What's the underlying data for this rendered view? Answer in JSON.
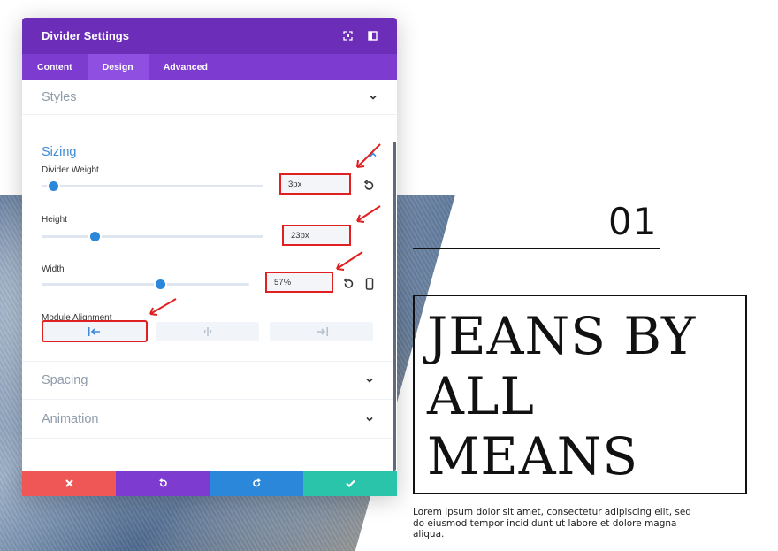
{
  "panel": {
    "title": "Divider Settings",
    "tabs": [
      {
        "label": "Content",
        "active": false
      },
      {
        "label": "Design",
        "active": true
      },
      {
        "label": "Advanced",
        "active": false
      }
    ],
    "sections": {
      "styles": "Styles",
      "sizing": "Sizing",
      "spacing": "Spacing",
      "animation": "Animation"
    },
    "fields": {
      "divider_weight": {
        "label": "Divider Weight",
        "value": "3px",
        "level": 0.05
      },
      "height": {
        "label": "Height",
        "value": "23px",
        "level": 0.24
      },
      "width": {
        "label": "Width",
        "value": "57%",
        "level": 0.57
      },
      "module_alignment": {
        "label": "Module Alignment",
        "selected": "left",
        "options": [
          "left",
          "center",
          "right"
        ]
      }
    },
    "colors": {
      "header": "#6c2eb9",
      "tabs": "#7d3bd0",
      "accent": "#2b87da",
      "cancel": "#ef5656",
      "undo": "#7d3bd0",
      "redo": "#2b87da",
      "save": "#29c4a9",
      "highlight": "#e02020"
    }
  },
  "content": {
    "number": "01",
    "headline_lines": [
      "JEANS BY",
      "ALL",
      "MEANS"
    ],
    "lorem": "Lorem ipsum dolor sit amet, consectetur adipiscing elit, sed do eiusmod tempor incididunt ut labore et dolore magna aliqua."
  }
}
